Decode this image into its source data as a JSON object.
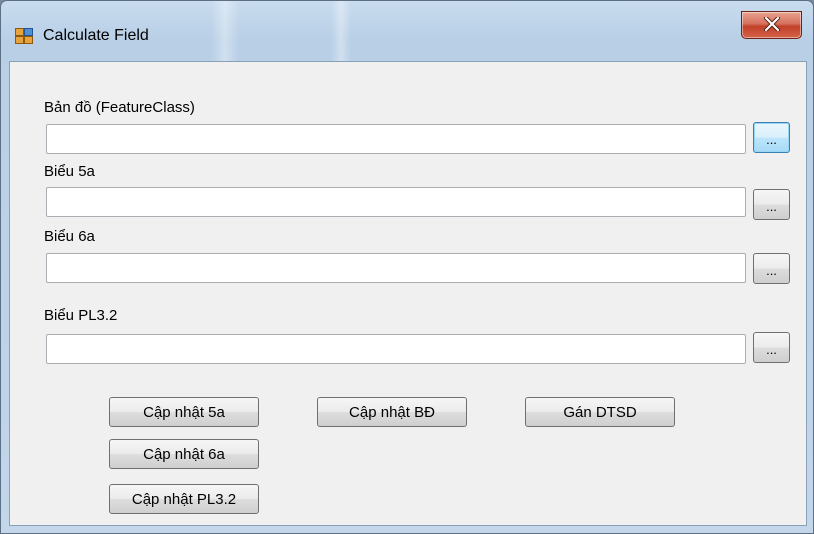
{
  "window": {
    "title": "Calculate Field",
    "close_glyph": "X",
    "icon": "form-app-icon"
  },
  "form": {
    "fields": [
      {
        "label": "Bản đồ (FeatureClass)",
        "value": "",
        "browse_label": "..."
      },
      {
        "label": "Biểu 5a",
        "value": "",
        "browse_label": "..."
      },
      {
        "label": "Biểu 6a",
        "value": "",
        "browse_label": "..."
      },
      {
        "label": "Biểu PL3.2",
        "value": "",
        "browse_label": "..."
      }
    ],
    "buttons": {
      "update_5a": "Cập nhật 5a",
      "update_bd": "Cập nhật BĐ",
      "assign_dtsd": "Gán DTSD",
      "update_6a": "Cập nhật 6a",
      "update_pl32": "Cập nhật PL3.2"
    }
  },
  "colors": {
    "close_button": "#c1412a",
    "focus_border": "#3c7fb1"
  }
}
